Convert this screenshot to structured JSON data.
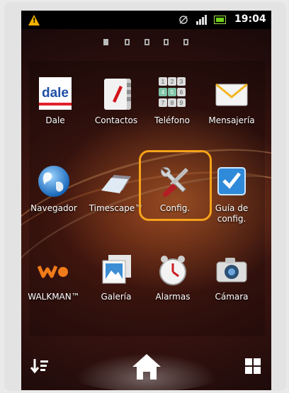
{
  "status_bar": {
    "time": "19:04",
    "warning_icon": "warning-icon",
    "vibrate_icon": "vibrate-icon",
    "signal_icon": "signal-bars-icon",
    "battery_icon": "battery-icon",
    "accent_warning": "#f2b100",
    "battery_color": "#6fd11a"
  },
  "pager": {
    "page_count": 5,
    "active_page": 1
  },
  "apps": [
    {
      "label": "Dale",
      "icon": "dale-icon",
      "logo_text": "dale"
    },
    {
      "label": "Contactos",
      "icon": "contacts-icon"
    },
    {
      "label": "Teléfono",
      "icon": "dialpad-icon",
      "keys": [
        "1",
        "2",
        "3",
        "4",
        "5",
        "6",
        "7",
        "8",
        "9"
      ]
    },
    {
      "label": "Mensajería",
      "icon": "envelope-icon"
    },
    {
      "label": "Navegador",
      "icon": "globe-icon"
    },
    {
      "label": "Timescape™",
      "icon": "timescape-icon"
    },
    {
      "label": "Config.",
      "icon": "settings-wrench-icon"
    },
    {
      "label": "Guía de config.",
      "icon": "checkbox-guide-icon"
    },
    {
      "label": "WALKMAN™",
      "icon": "walkman-icon"
    },
    {
      "label": "Galería",
      "icon": "gallery-icon"
    },
    {
      "label": "Alarmas",
      "icon": "alarm-clock-icon"
    },
    {
      "label": "Cámara",
      "icon": "camera-icon"
    }
  ],
  "highlight_color": "#f7a21a",
  "nav": {
    "sort_icon": "sort-icon",
    "home_icon": "home-icon",
    "apps_icon": "app-grid-icon"
  }
}
